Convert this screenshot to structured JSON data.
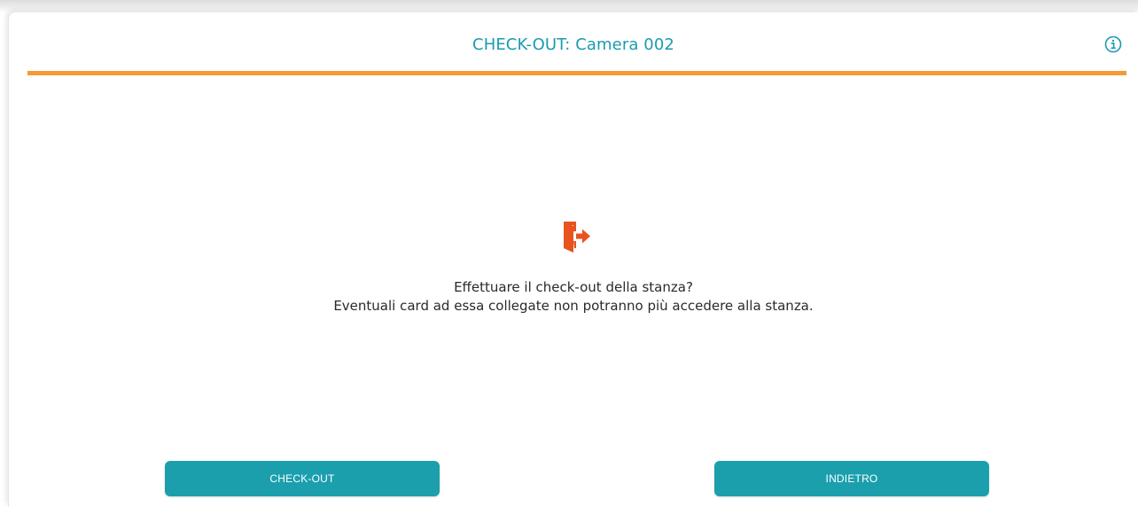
{
  "dialog": {
    "title": "CHECK-OUT: Camera 002",
    "accent_color": "#f59a35",
    "title_color": "#1a9bb0",
    "info_icon": "info-circle-icon",
    "exit_icon": "door-exit-icon",
    "message_line1": "Effettuare il check-out della stanza?",
    "message_line2": "Eventuali card ad essa collegate non potranno più accedere alla stanza."
  },
  "buttons": {
    "checkout_label": "CHECK-OUT",
    "back_label": "INDIETRO",
    "color": "#1b9fad"
  }
}
